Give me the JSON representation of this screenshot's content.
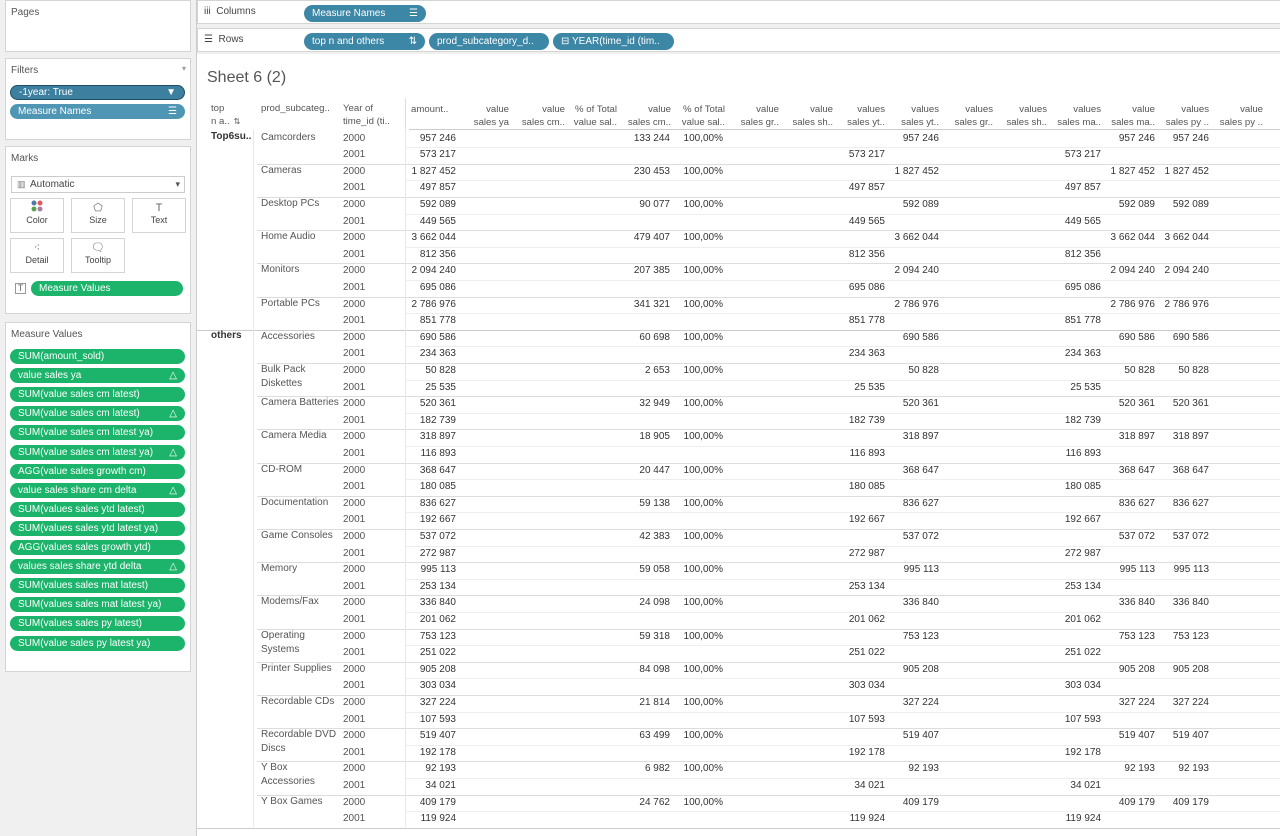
{
  "pages_title": "Pages",
  "filters": {
    "title": "Filters",
    "items": [
      "-1year: True",
      "Measure Names"
    ]
  },
  "marks": {
    "title": "Marks",
    "type": "Automatic",
    "buttons": [
      "Color",
      "Size",
      "Text",
      "Detail",
      "Tooltip"
    ],
    "text_pill": "Measure Values"
  },
  "measure_values": {
    "title": "Measure Values",
    "items": [
      {
        "label": "SUM(amount_sold)",
        "delta": false
      },
      {
        "label": "value sales ya",
        "delta": true
      },
      {
        "label": "SUM(value sales cm latest)",
        "delta": false
      },
      {
        "label": "SUM(value sales cm latest)",
        "delta": true
      },
      {
        "label": "SUM(value sales cm latest ya)",
        "delta": false
      },
      {
        "label": "SUM(value sales cm latest ya)",
        "delta": true
      },
      {
        "label": "AGG(value sales growth cm)",
        "delta": false
      },
      {
        "label": "value sales share cm delta",
        "delta": true
      },
      {
        "label": "SUM(values sales ytd latest)",
        "delta": false
      },
      {
        "label": "SUM(values sales ytd latest ya)",
        "delta": false
      },
      {
        "label": "AGG(values sales growth ytd)",
        "delta": false
      },
      {
        "label": "values sales share ytd delta",
        "delta": true
      },
      {
        "label": "SUM(values sales mat latest)",
        "delta": false
      },
      {
        "label": "SUM(values sales mat latest ya)",
        "delta": false
      },
      {
        "label": "SUM(values sales py latest)",
        "delta": false
      },
      {
        "label": "SUM(value sales py latest ya)",
        "delta": false
      }
    ]
  },
  "shelves": {
    "columns_label": "Columns",
    "rows_label": "Rows",
    "columns": [
      "Measure Names"
    ],
    "rows": [
      "top n and others",
      "prod_subcategory_d..",
      "YEAR(time_id (tim.."
    ]
  },
  "sheet_title": "Sheet 6 (2)",
  "headers": [
    "top\nn a..",
    "prod_subcateg..",
    "Year of\ntime_id (ti..",
    "amount..",
    "value\nsales ya",
    "value\nsales cm..",
    "% of Total\nvalue sal..",
    "value\nsales cm..",
    "% of Total\nvalue sal..",
    "value\nsales gr..",
    "value\nsales sh..",
    "values\nsales yt..",
    "values\nsales yt..",
    "values\nsales gr..",
    "values\nsales sh..",
    "values\nsales ma..",
    "value\nsales ma..",
    "values\nsales py ..",
    "value\nsales py .."
  ],
  "groups": [
    {
      "name": "Top6su..",
      "subcats": [
        {
          "name": "Camcorders",
          "rows": [
            {
              "year": "2000",
              "amount": "957 246",
              "cm": "133 244",
              "pct": "100,00%",
              "ytd_ya": "",
              "ytd": "957 246",
              "mat": "",
              "mat_ya": "957 246",
              "py": "957 246"
            },
            {
              "year": "2001",
              "amount": "573 217",
              "cm": "",
              "pct": "",
              "ytd_ya": "573 217",
              "ytd": "",
              "mat": "573 217",
              "mat_ya": "",
              "py": ""
            }
          ]
        },
        {
          "name": "Cameras",
          "rows": [
            {
              "year": "2000",
              "amount": "1 827 452",
              "cm": "230 453",
              "pct": "100,00%",
              "ytd_ya": "",
              "ytd": "1 827 452",
              "mat": "",
              "mat_ya": "1 827 452",
              "py": "1 827 452"
            },
            {
              "year": "2001",
              "amount": "497 857",
              "cm": "",
              "pct": "",
              "ytd_ya": "497 857",
              "ytd": "",
              "mat": "497 857",
              "mat_ya": "",
              "py": ""
            }
          ]
        },
        {
          "name": "Desktop PCs",
          "rows": [
            {
              "year": "2000",
              "amount": "592 089",
              "cm": "90 077",
              "pct": "100,00%",
              "ytd_ya": "",
              "ytd": "592 089",
              "mat": "",
              "mat_ya": "592 089",
              "py": "592 089"
            },
            {
              "year": "2001",
              "amount": "449 565",
              "cm": "",
              "pct": "",
              "ytd_ya": "449 565",
              "ytd": "",
              "mat": "449 565",
              "mat_ya": "",
              "py": ""
            }
          ]
        },
        {
          "name": "Home Audio",
          "rows": [
            {
              "year": "2000",
              "amount": "3 662 044",
              "cm": "479 407",
              "pct": "100,00%",
              "ytd_ya": "",
              "ytd": "3 662 044",
              "mat": "",
              "mat_ya": "3 662 044",
              "py": "3 662 044"
            },
            {
              "year": "2001",
              "amount": "812 356",
              "cm": "",
              "pct": "",
              "ytd_ya": "812 356",
              "ytd": "",
              "mat": "812 356",
              "mat_ya": "",
              "py": ""
            }
          ]
        },
        {
          "name": "Monitors",
          "rows": [
            {
              "year": "2000",
              "amount": "2 094 240",
              "cm": "207 385",
              "pct": "100,00%",
              "ytd_ya": "",
              "ytd": "2 094 240",
              "mat": "",
              "mat_ya": "2 094 240",
              "py": "2 094 240"
            },
            {
              "year": "2001",
              "amount": "695 086",
              "cm": "",
              "pct": "",
              "ytd_ya": "695 086",
              "ytd": "",
              "mat": "695 086",
              "mat_ya": "",
              "py": ""
            }
          ]
        },
        {
          "name": "Portable PCs",
          "rows": [
            {
              "year": "2000",
              "amount": "2 786 976",
              "cm": "341 321",
              "pct": "100,00%",
              "ytd_ya": "",
              "ytd": "2 786 976",
              "mat": "",
              "mat_ya": "2 786 976",
              "py": "2 786 976"
            },
            {
              "year": "2001",
              "amount": "851 778",
              "cm": "",
              "pct": "",
              "ytd_ya": "851 778",
              "ytd": "",
              "mat": "851 778",
              "mat_ya": "",
              "py": ""
            }
          ]
        }
      ]
    },
    {
      "name": "others",
      "subcats": [
        {
          "name": "Accessories",
          "rows": [
            {
              "year": "2000",
              "amount": "690 586",
              "cm": "60 698",
              "pct": "100,00%",
              "ytd_ya": "",
              "ytd": "690 586",
              "mat": "",
              "mat_ya": "690 586",
              "py": "690 586"
            },
            {
              "year": "2001",
              "amount": "234 363",
              "cm": "",
              "pct": "",
              "ytd_ya": "234 363",
              "ytd": "",
              "mat": "234 363",
              "mat_ya": "",
              "py": ""
            }
          ]
        },
        {
          "name": "Bulk Pack Diskettes",
          "rows": [
            {
              "year": "2000",
              "amount": "50 828",
              "cm": "2 653",
              "pct": "100,00%",
              "ytd_ya": "",
              "ytd": "50 828",
              "mat": "",
              "mat_ya": "50 828",
              "py": "50 828"
            },
            {
              "year": "2001",
              "amount": "25 535",
              "cm": "",
              "pct": "",
              "ytd_ya": "25 535",
              "ytd": "",
              "mat": "25 535",
              "mat_ya": "",
              "py": ""
            }
          ]
        },
        {
          "name": "Camera Batteries",
          "rows": [
            {
              "year": "2000",
              "amount": "520 361",
              "cm": "32 949",
              "pct": "100,00%",
              "ytd_ya": "",
              "ytd": "520 361",
              "mat": "",
              "mat_ya": "520 361",
              "py": "520 361"
            },
            {
              "year": "2001",
              "amount": "182 739",
              "cm": "",
              "pct": "",
              "ytd_ya": "182 739",
              "ytd": "",
              "mat": "182 739",
              "mat_ya": "",
              "py": ""
            }
          ]
        },
        {
          "name": "Camera Media",
          "rows": [
            {
              "year": "2000",
              "amount": "318 897",
              "cm": "18 905",
              "pct": "100,00%",
              "ytd_ya": "",
              "ytd": "318 897",
              "mat": "",
              "mat_ya": "318 897",
              "py": "318 897"
            },
            {
              "year": "2001",
              "amount": "116 893",
              "cm": "",
              "pct": "",
              "ytd_ya": "116 893",
              "ytd": "",
              "mat": "116 893",
              "mat_ya": "",
              "py": ""
            }
          ]
        },
        {
          "name": "CD-ROM",
          "rows": [
            {
              "year": "2000",
              "amount": "368 647",
              "cm": "20 447",
              "pct": "100,00%",
              "ytd_ya": "",
              "ytd": "368 647",
              "mat": "",
              "mat_ya": "368 647",
              "py": "368 647"
            },
            {
              "year": "2001",
              "amount": "180 085",
              "cm": "",
              "pct": "",
              "ytd_ya": "180 085",
              "ytd": "",
              "mat": "180 085",
              "mat_ya": "",
              "py": ""
            }
          ]
        },
        {
          "name": "Documentation",
          "rows": [
            {
              "year": "2000",
              "amount": "836 627",
              "cm": "59 138",
              "pct": "100,00%",
              "ytd_ya": "",
              "ytd": "836 627",
              "mat": "",
              "mat_ya": "836 627",
              "py": "836 627"
            },
            {
              "year": "2001",
              "amount": "192 667",
              "cm": "",
              "pct": "",
              "ytd_ya": "192 667",
              "ytd": "",
              "mat": "192 667",
              "mat_ya": "",
              "py": ""
            }
          ]
        },
        {
          "name": "Game Consoles",
          "rows": [
            {
              "year": "2000",
              "amount": "537 072",
              "cm": "42 383",
              "pct": "100,00%",
              "ytd_ya": "",
              "ytd": "537 072",
              "mat": "",
              "mat_ya": "537 072",
              "py": "537 072"
            },
            {
              "year": "2001",
              "amount": "272 987",
              "cm": "",
              "pct": "",
              "ytd_ya": "272 987",
              "ytd": "",
              "mat": "272 987",
              "mat_ya": "",
              "py": ""
            }
          ]
        },
        {
          "name": "Memory",
          "rows": [
            {
              "year": "2000",
              "amount": "995 113",
              "cm": "59 058",
              "pct": "100,00%",
              "ytd_ya": "",
              "ytd": "995 113",
              "mat": "",
              "mat_ya": "995 113",
              "py": "995 113"
            },
            {
              "year": "2001",
              "amount": "253 134",
              "cm": "",
              "pct": "",
              "ytd_ya": "253 134",
              "ytd": "",
              "mat": "253 134",
              "mat_ya": "",
              "py": ""
            }
          ]
        },
        {
          "name": "Modems/Fax",
          "rows": [
            {
              "year": "2000",
              "amount": "336 840",
              "cm": "24 098",
              "pct": "100,00%",
              "ytd_ya": "",
              "ytd": "336 840",
              "mat": "",
              "mat_ya": "336 840",
              "py": "336 840"
            },
            {
              "year": "2001",
              "amount": "201 062",
              "cm": "",
              "pct": "",
              "ytd_ya": "201 062",
              "ytd": "",
              "mat": "201 062",
              "mat_ya": "",
              "py": ""
            }
          ]
        },
        {
          "name": "Operating Systems",
          "rows": [
            {
              "year": "2000",
              "amount": "753 123",
              "cm": "59 318",
              "pct": "100,00%",
              "ytd_ya": "",
              "ytd": "753 123",
              "mat": "",
              "mat_ya": "753 123",
              "py": "753 123"
            },
            {
              "year": "2001",
              "amount": "251 022",
              "cm": "",
              "pct": "",
              "ytd_ya": "251 022",
              "ytd": "",
              "mat": "251 022",
              "mat_ya": "",
              "py": ""
            }
          ]
        },
        {
          "name": "Printer Supplies",
          "rows": [
            {
              "year": "2000",
              "amount": "905 208",
              "cm": "84 098",
              "pct": "100,00%",
              "ytd_ya": "",
              "ytd": "905 208",
              "mat": "",
              "mat_ya": "905 208",
              "py": "905 208"
            },
            {
              "year": "2001",
              "amount": "303 034",
              "cm": "",
              "pct": "",
              "ytd_ya": "303 034",
              "ytd": "",
              "mat": "303 034",
              "mat_ya": "",
              "py": ""
            }
          ]
        },
        {
          "name": "Recordable CDs",
          "rows": [
            {
              "year": "2000",
              "amount": "327 224",
              "cm": "21 814",
              "pct": "100,00%",
              "ytd_ya": "",
              "ytd": "327 224",
              "mat": "",
              "mat_ya": "327 224",
              "py": "327 224"
            },
            {
              "year": "2001",
              "amount": "107 593",
              "cm": "",
              "pct": "",
              "ytd_ya": "107 593",
              "ytd": "",
              "mat": "107 593",
              "mat_ya": "",
              "py": ""
            }
          ]
        },
        {
          "name": "Recordable DVD Discs",
          "rows": [
            {
              "year": "2000",
              "amount": "519 407",
              "cm": "63 499",
              "pct": "100,00%",
              "ytd_ya": "",
              "ytd": "519 407",
              "mat": "",
              "mat_ya": "519 407",
              "py": "519 407"
            },
            {
              "year": "2001",
              "amount": "192 178",
              "cm": "",
              "pct": "",
              "ytd_ya": "192 178",
              "ytd": "",
              "mat": "192 178",
              "mat_ya": "",
              "py": ""
            }
          ]
        },
        {
          "name": "Y Box Accessories",
          "rows": [
            {
              "year": "2000",
              "amount": "92 193",
              "cm": "6 982",
              "pct": "100,00%",
              "ytd_ya": "",
              "ytd": "92 193",
              "mat": "",
              "mat_ya": "92 193",
              "py": "92 193"
            },
            {
              "year": "2001",
              "amount": "34 021",
              "cm": "",
              "pct": "",
              "ytd_ya": "34 021",
              "ytd": "",
              "mat": "34 021",
              "mat_ya": "",
              "py": ""
            }
          ]
        },
        {
          "name": "Y Box Games",
          "rows": [
            {
              "year": "2000",
              "amount": "409 179",
              "cm": "24 762",
              "pct": "100,00%",
              "ytd_ya": "",
              "ytd": "409 179",
              "mat": "",
              "mat_ya": "409 179",
              "py": "409 179"
            },
            {
              "year": "2001",
              "amount": "119 924",
              "cm": "",
              "pct": "",
              "ytd_ya": "119 924",
              "ytd": "",
              "mat": "119 924",
              "mat_ya": "",
              "py": ""
            }
          ]
        }
      ]
    }
  ]
}
